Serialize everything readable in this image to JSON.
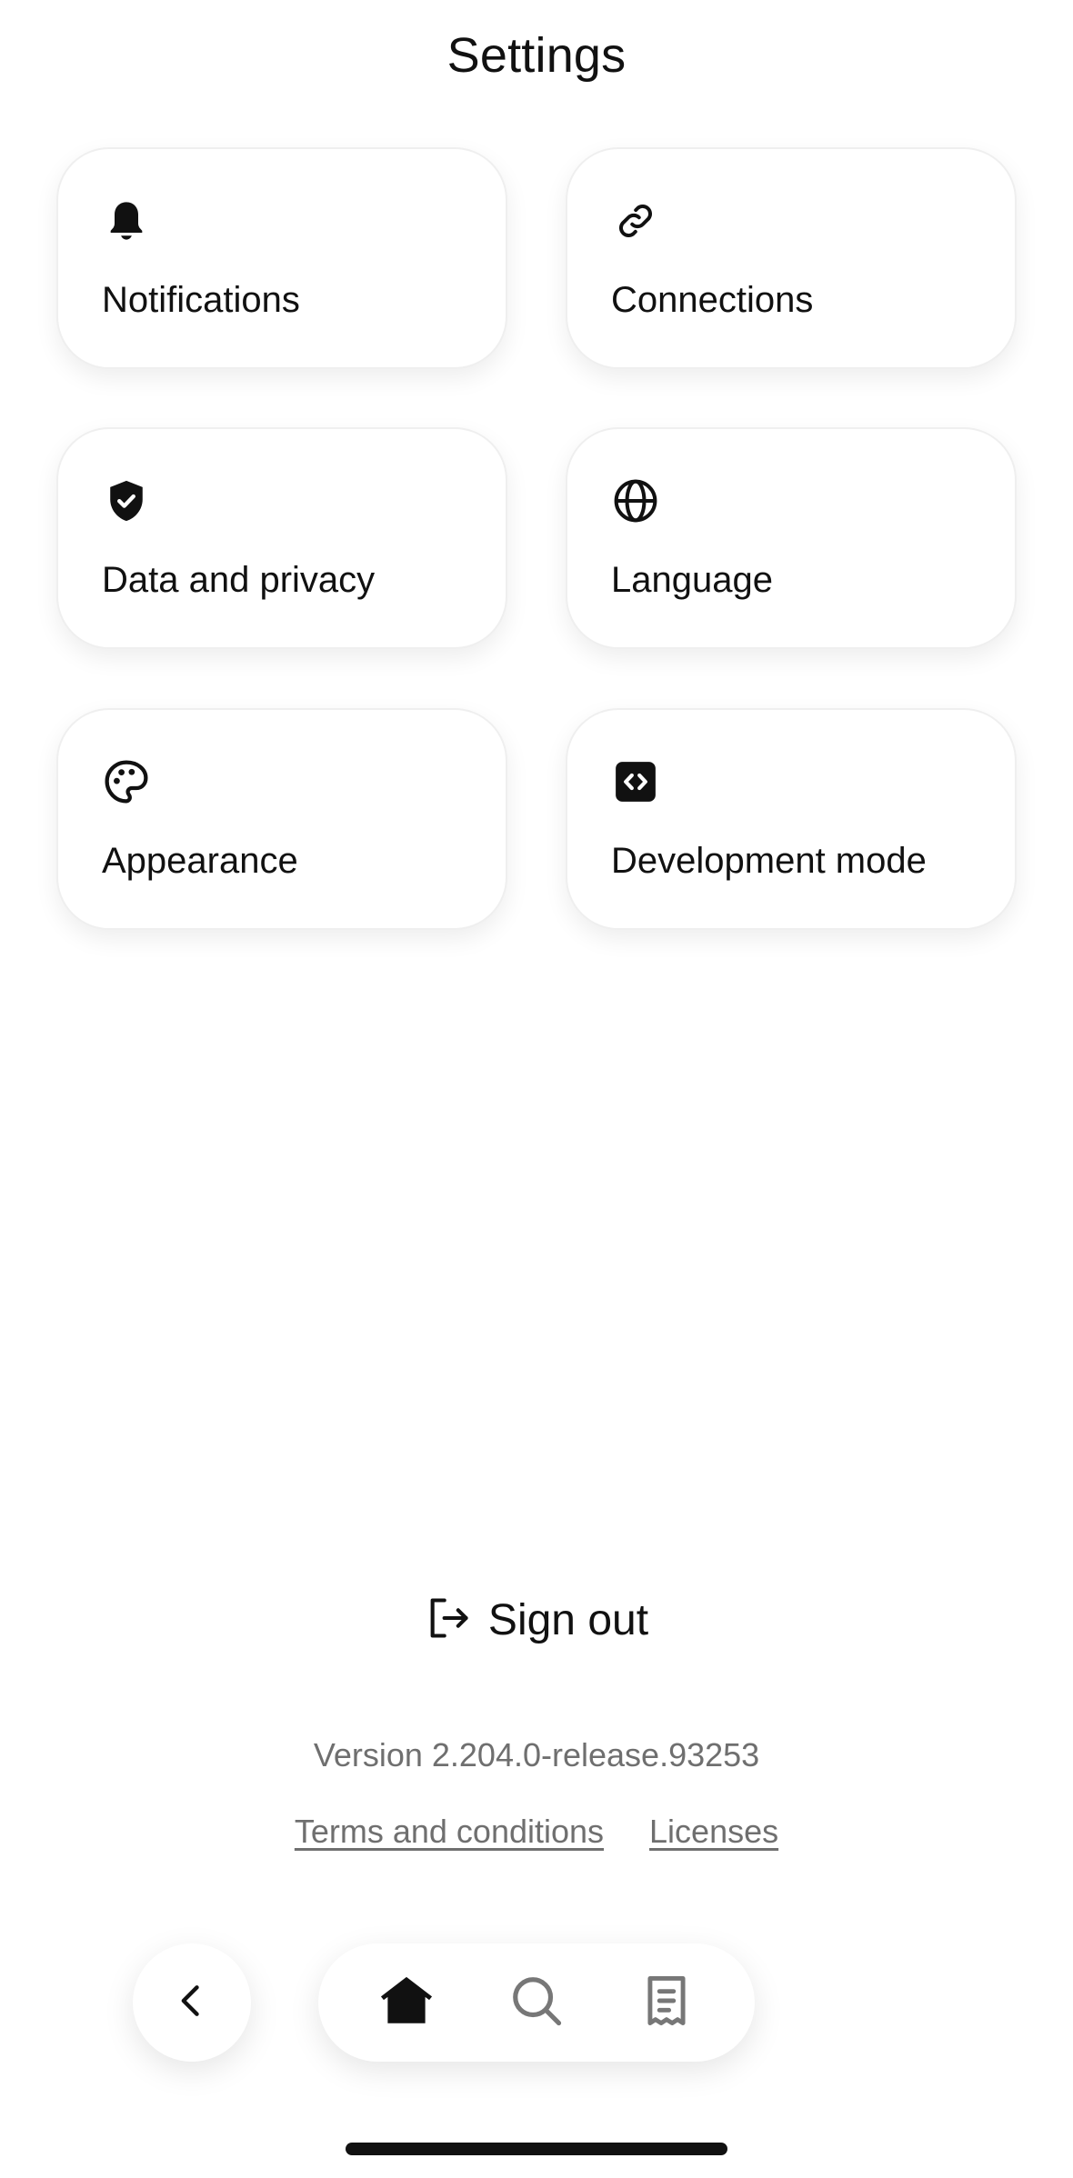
{
  "header": {
    "title": "Settings"
  },
  "cards": [
    {
      "label": "Notifications",
      "icon": "bell-icon"
    },
    {
      "label": "Connections",
      "icon": "link-icon"
    },
    {
      "label": "Data and privacy",
      "icon": "shield-check-icon"
    },
    {
      "label": "Language",
      "icon": "globe-icon"
    },
    {
      "label": "Appearance",
      "icon": "palette-icon"
    },
    {
      "label": "Development mode",
      "icon": "code-icon"
    }
  ],
  "sign_out": {
    "label": "Sign out",
    "icon": "sign-out-icon"
  },
  "footer": {
    "version": "Version 2.204.0-release.93253",
    "terms_label": "Terms and conditions",
    "licenses_label": "Licenses"
  },
  "nav": {
    "back_icon": "chevron-left-icon",
    "tabs": [
      {
        "name": "home",
        "icon": "home-icon",
        "active": true
      },
      {
        "name": "search",
        "icon": "search-icon",
        "active": false
      },
      {
        "name": "receipt",
        "icon": "receipt-icon",
        "active": false
      }
    ]
  },
  "colors": {
    "text_primary": "#111111",
    "text_secondary": "#6f6f6f",
    "icon_inactive": "#777777",
    "background": "#ffffff",
    "card_border": "#efefef"
  }
}
